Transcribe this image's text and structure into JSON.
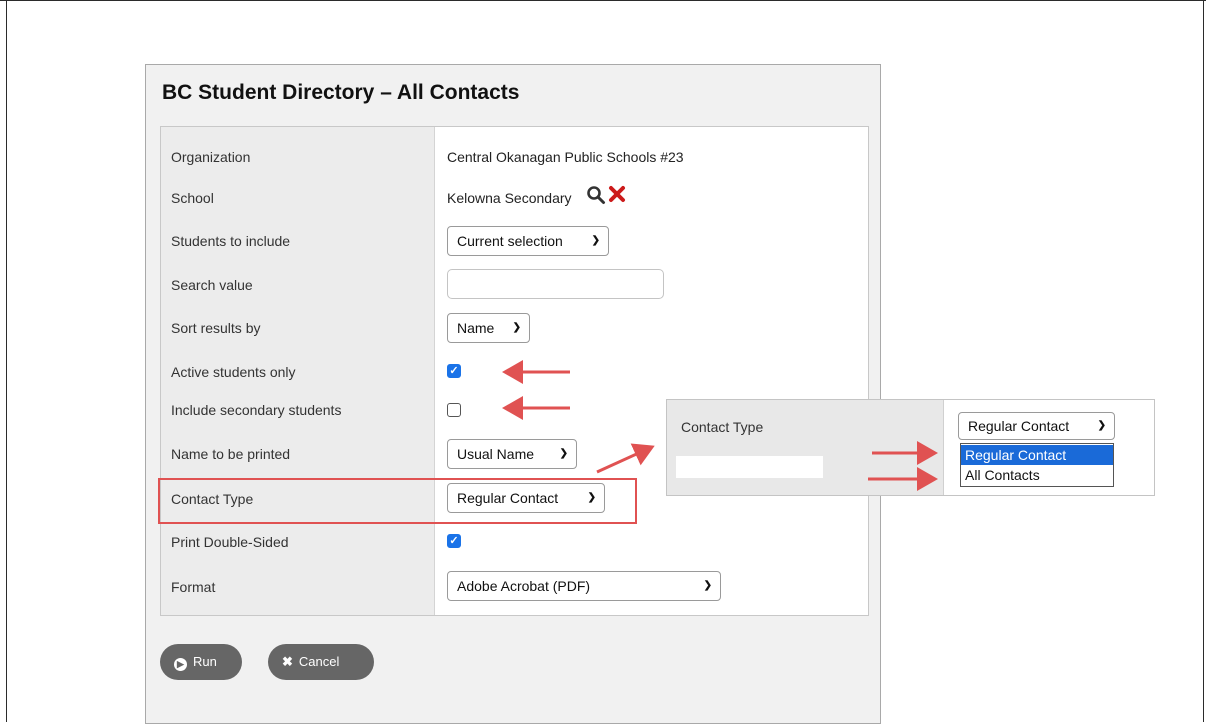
{
  "dialog": {
    "title": "BC Student Directory – All Contacts"
  },
  "fields": {
    "organization": {
      "label": "Organization",
      "value": "Central Okanagan Public Schools #23"
    },
    "school": {
      "label": "School",
      "value": "Kelowna Secondary",
      "search_icon": "search-icon",
      "clear_icon": "close-icon"
    },
    "students_to_include": {
      "label": "Students to include",
      "value": "Current selection"
    },
    "search_value": {
      "label": "Search value",
      "value": ""
    },
    "sort_results_by": {
      "label": "Sort results by",
      "value": "Name"
    },
    "active_students_only": {
      "label": "Active students only",
      "checked": true
    },
    "include_secondary": {
      "label": "Include secondary students",
      "checked": false
    },
    "name_to_be_printed": {
      "label": "Name to be printed",
      "value": "Usual Name"
    },
    "contact_type": {
      "label": "Contact Type",
      "value": "Regular Contact"
    },
    "print_double_sided": {
      "label": "Print Double-Sided",
      "checked": true
    },
    "format": {
      "label": "Format",
      "value": "Adobe Acrobat (PDF)"
    }
  },
  "buttons": {
    "run": "Run",
    "cancel": "Cancel"
  },
  "callout": {
    "label": "Contact Type",
    "select_value": "Regular Contact",
    "options": [
      "Regular Contact",
      "All Contacts"
    ],
    "selected_option": "Regular Contact"
  },
  "colors": {
    "annotation_red": "#e05252",
    "checkbox_blue": "#1a73e8",
    "option_highlight": "#1a6ad8",
    "button_gray": "#666666"
  }
}
